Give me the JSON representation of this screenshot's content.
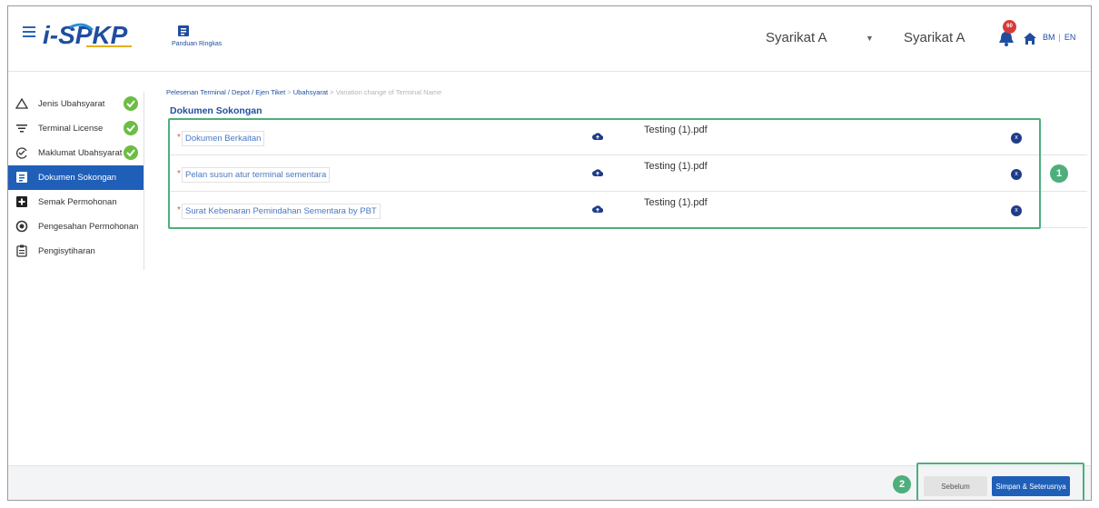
{
  "header": {
    "logo_text": "i-SPKP",
    "guide_label": "Panduan Ringkas",
    "company_selector": "Syarikat A",
    "company_name": "Syarikat A",
    "notification_count": "60",
    "lang_bm": "BM",
    "lang_sep": "|",
    "lang_en": "EN"
  },
  "sidebar": {
    "items": [
      {
        "label": "Jenis Ubahsyarat",
        "icon": "triangle-icon",
        "completed": true
      },
      {
        "label": "Terminal License",
        "icon": "filter-icon",
        "completed": true
      },
      {
        "label": "Maklumat Ubahsyarat",
        "icon": "edit-check-icon",
        "completed": true
      },
      {
        "label": "Dokumen Sokongan",
        "icon": "document-list-icon",
        "completed": false,
        "active": true
      },
      {
        "label": "Semak Permohonan",
        "icon": "review-icon",
        "completed": false
      },
      {
        "label": "Pengesahan Permohonan",
        "icon": "verify-icon",
        "completed": false
      },
      {
        "label": "Pengisytiharan",
        "icon": "clipboard-icon",
        "completed": false
      }
    ]
  },
  "breadcrumb": {
    "part1": "Pelesenan Terminal / Depot / Ejen Tiket",
    "sep": ">",
    "part2": "Ubahsyarat",
    "current": "Variation change of Terminal Name"
  },
  "section_title": "Dokumen Sokongan",
  "documents": [
    {
      "label": "Dokumen Berkaitan",
      "file": "Testing (1).pdf"
    },
    {
      "label": "Pelan susun atur terminal sementara",
      "file": "Testing (1).pdf"
    },
    {
      "label": "Surat Kebenaran Pemindahan Sementara by PBT",
      "file": "Testing (1).pdf"
    }
  ],
  "required_mark": "*",
  "remove_mark": "x",
  "markers": {
    "one": "1",
    "two": "2"
  },
  "footer": {
    "prev_label": "Sebelum",
    "next_label": "Simpan & Seterusnya"
  },
  "colors": {
    "primary": "#1f5fb8",
    "success": "#6bbd45",
    "highlight": "#4daf7c",
    "badge": "#d93a3a"
  }
}
